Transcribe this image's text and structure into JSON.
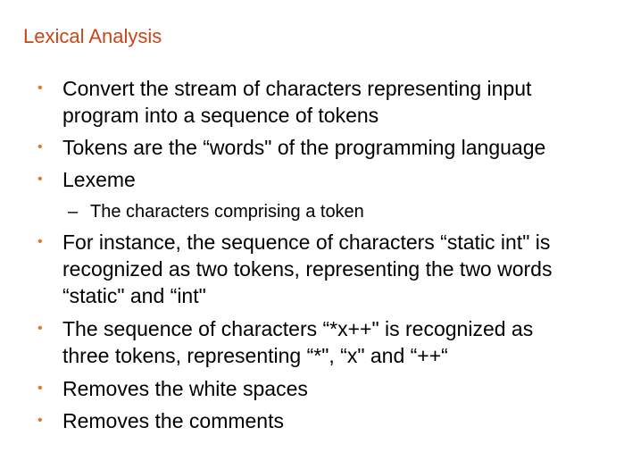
{
  "title": "Lexical Analysis",
  "colors": {
    "title": "#c8461a",
    "bullet": "#e07a1f",
    "text": "#000000"
  },
  "bullets": [
    {
      "symbol": "•",
      "text": "Convert the stream of characters representing input\nprogram into a sequence of tokens"
    },
    {
      "symbol": "•",
      "text": "Tokens are the “words\" of the programming language"
    },
    {
      "symbol": "•",
      "text": "Lexeme"
    },
    {
      "symbol": "•",
      "text": "For instance, the sequence of characters “static int\" is\nrecognized as two tokens, representing the two words\n“static\" and “int\""
    },
    {
      "symbol": "•",
      "text": "The sequence of characters “*x++\" is recognized as\nthree tokens, representing “*\", “x\" and “++“"
    },
    {
      "symbol": "•",
      "text": "Removes the white spaces"
    },
    {
      "symbol": "•",
      "text": "Removes the comments"
    }
  ],
  "sub_bullets": [
    {
      "symbol": "–",
      "text": "The characters comprising a token"
    }
  ]
}
